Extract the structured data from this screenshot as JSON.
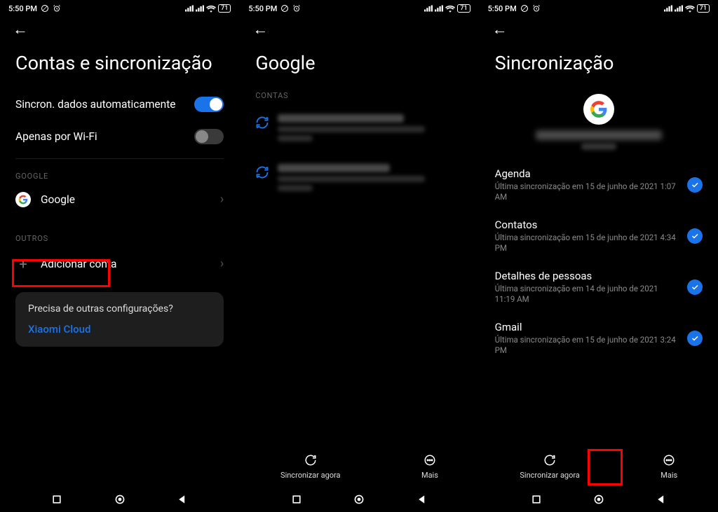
{
  "status": {
    "time": "5:50 PM",
    "battery": "71"
  },
  "screen1": {
    "title": "Contas e sincronização",
    "auto_sync_label": "Sincron. dados automaticamente",
    "wifi_only_label": "Apenas por Wi-Fi",
    "section_google": "GOOGLE",
    "google_label": "Google",
    "section_others": "OUTROS",
    "add_account_label": "Adicionar conta",
    "card_question": "Precisa de outras configurações?",
    "card_link": "Xiaomi Cloud"
  },
  "screen2": {
    "title": "Google",
    "section_accounts": "CONTAS"
  },
  "screen3": {
    "title": "Sincronização",
    "items": [
      {
        "name": "Agenda",
        "sub": "Última sincronização em 15 de junho de 2021 1:07 AM"
      },
      {
        "name": "Contatos",
        "sub": "Última sincronização em 15 de junho de 2021 4:34 PM"
      },
      {
        "name": "Detalhes de pessoas",
        "sub": "Última sincronização em 14 de junho de 2021 11:19 AM"
      },
      {
        "name": "Gmail",
        "sub": "Última sincronização em 15 de junho de 2021 3:24 PM"
      }
    ]
  },
  "bottom": {
    "sync_now": "Sincronizar agora",
    "more": "Mais"
  }
}
